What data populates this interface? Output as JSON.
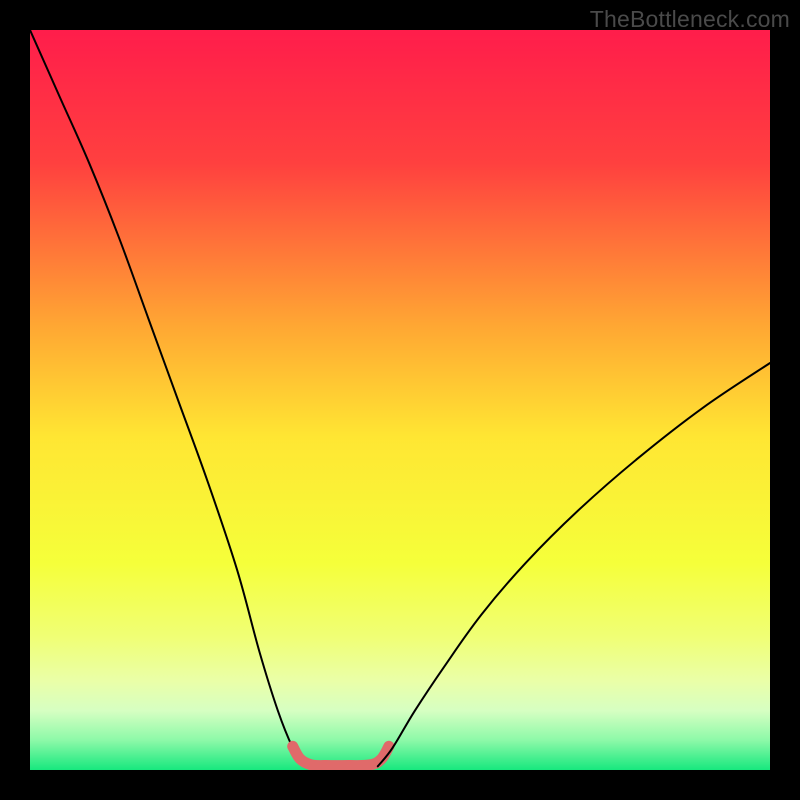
{
  "watermark": "TheBottleneck.com",
  "chart_data": {
    "type": "line",
    "title": "",
    "xlabel": "",
    "ylabel": "",
    "xlim": [
      0,
      100
    ],
    "ylim": [
      0,
      100
    ],
    "gradient_stops": [
      {
        "offset": 0,
        "color": "#ff1d4b"
      },
      {
        "offset": 18,
        "color": "#ff403f"
      },
      {
        "offset": 40,
        "color": "#ffa733"
      },
      {
        "offset": 55,
        "color": "#ffe633"
      },
      {
        "offset": 72,
        "color": "#f5ff3a"
      },
      {
        "offset": 82,
        "color": "#f0ff75"
      },
      {
        "offset": 88,
        "color": "#eaffa8"
      },
      {
        "offset": 92,
        "color": "#d6ffc2"
      },
      {
        "offset": 96,
        "color": "#8cf9a8"
      },
      {
        "offset": 100,
        "color": "#17e87e"
      }
    ],
    "series": [
      {
        "name": "bottleneck-curve-left",
        "stroke": "#000000",
        "x": [
          0,
          4,
          8,
          12,
          16,
          20,
          24,
          28,
          31,
          33.5,
          35.5,
          37
        ],
        "y": [
          100,
          91,
          82,
          72,
          61,
          50,
          39,
          27,
          16,
          8,
          3,
          0.5
        ]
      },
      {
        "name": "optimal-zone-marker",
        "stroke": "#e06a6a",
        "x": [
          35.5,
          36.5,
          38,
          40,
          43,
          46,
          47.5,
          48.5
        ],
        "y": [
          3.2,
          1.5,
          0.7,
          0.6,
          0.6,
          0.7,
          1.5,
          3.2
        ]
      },
      {
        "name": "bottleneck-curve-right",
        "stroke": "#000000",
        "x": [
          47,
          49,
          52,
          56,
          61,
          67,
          74,
          82,
          91,
          100
        ],
        "y": [
          0.5,
          3,
          8,
          14,
          21,
          28,
          35,
          42,
          49,
          55
        ]
      }
    ]
  }
}
